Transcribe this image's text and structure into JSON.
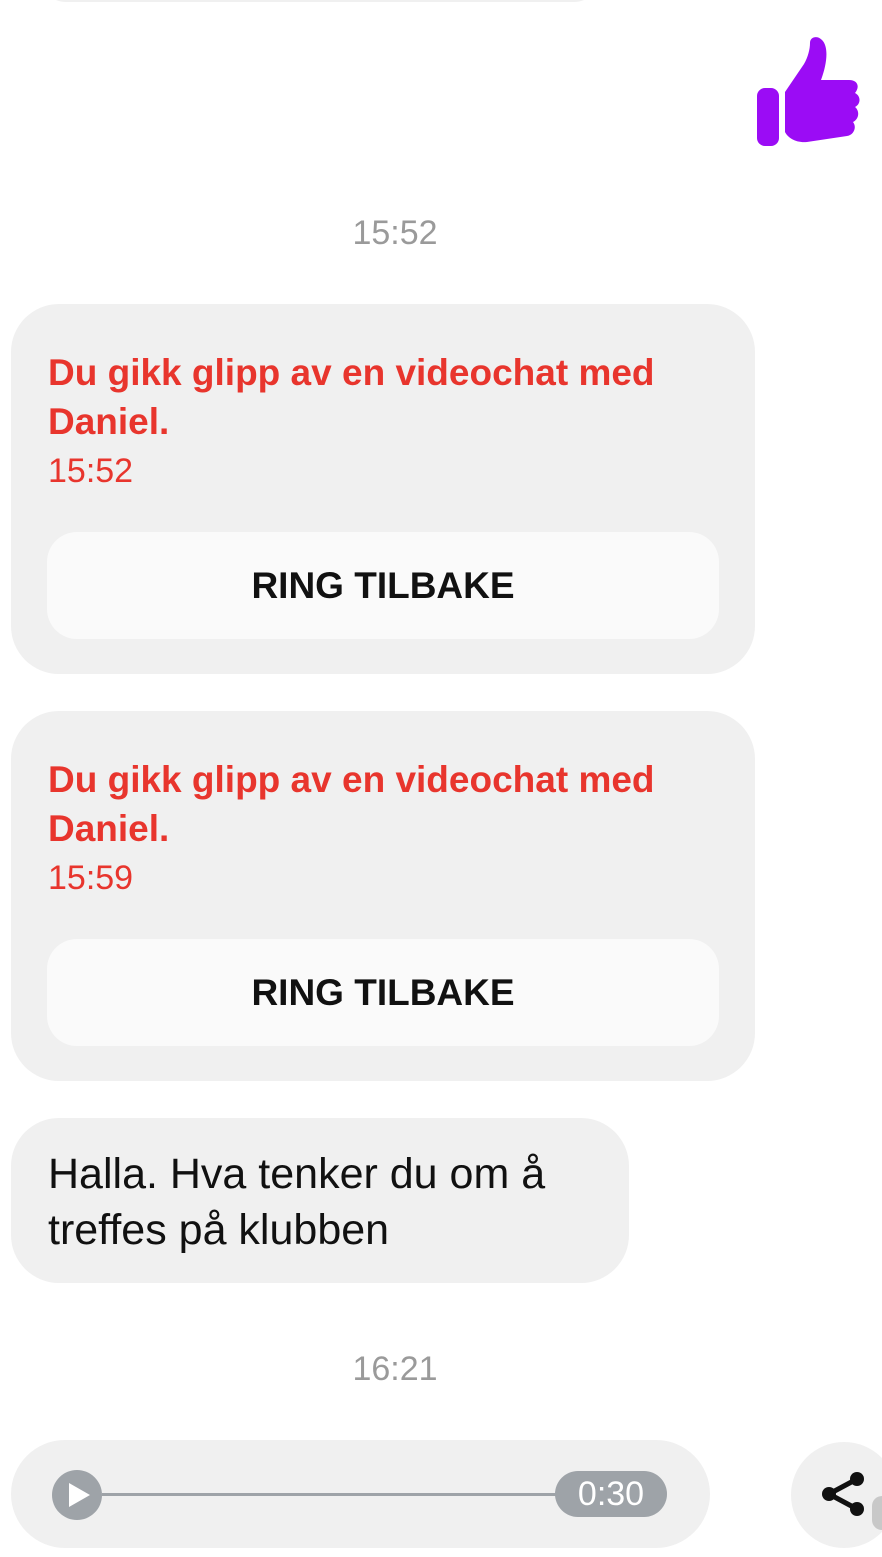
{
  "colors": {
    "like": "#9b0cf5",
    "missed_call": "#e8352d",
    "bubble": "#f0f0f0",
    "button": "#fafafa",
    "muted": "#9a9a9a"
  },
  "reactions": {
    "like_icon": "thumbs-up-icon"
  },
  "timestamps": [
    "15:52",
    "16:21"
  ],
  "missed_calls": [
    {
      "text": "Du gikk glipp av en videochat  med Daniel.",
      "time": "15:52",
      "button_label": "RING TILBAKE"
    },
    {
      "text": "Du gikk glipp av en videochat  med Daniel.",
      "time": "15:59",
      "button_label": "RING TILBAKE"
    }
  ],
  "message": {
    "text": "Halla. Hva tenker du om å treffes på klubben"
  },
  "audio": {
    "duration": "0:30",
    "progress": 0,
    "play_icon": "play-icon"
  },
  "actions": {
    "share_icon": "share-icon"
  }
}
